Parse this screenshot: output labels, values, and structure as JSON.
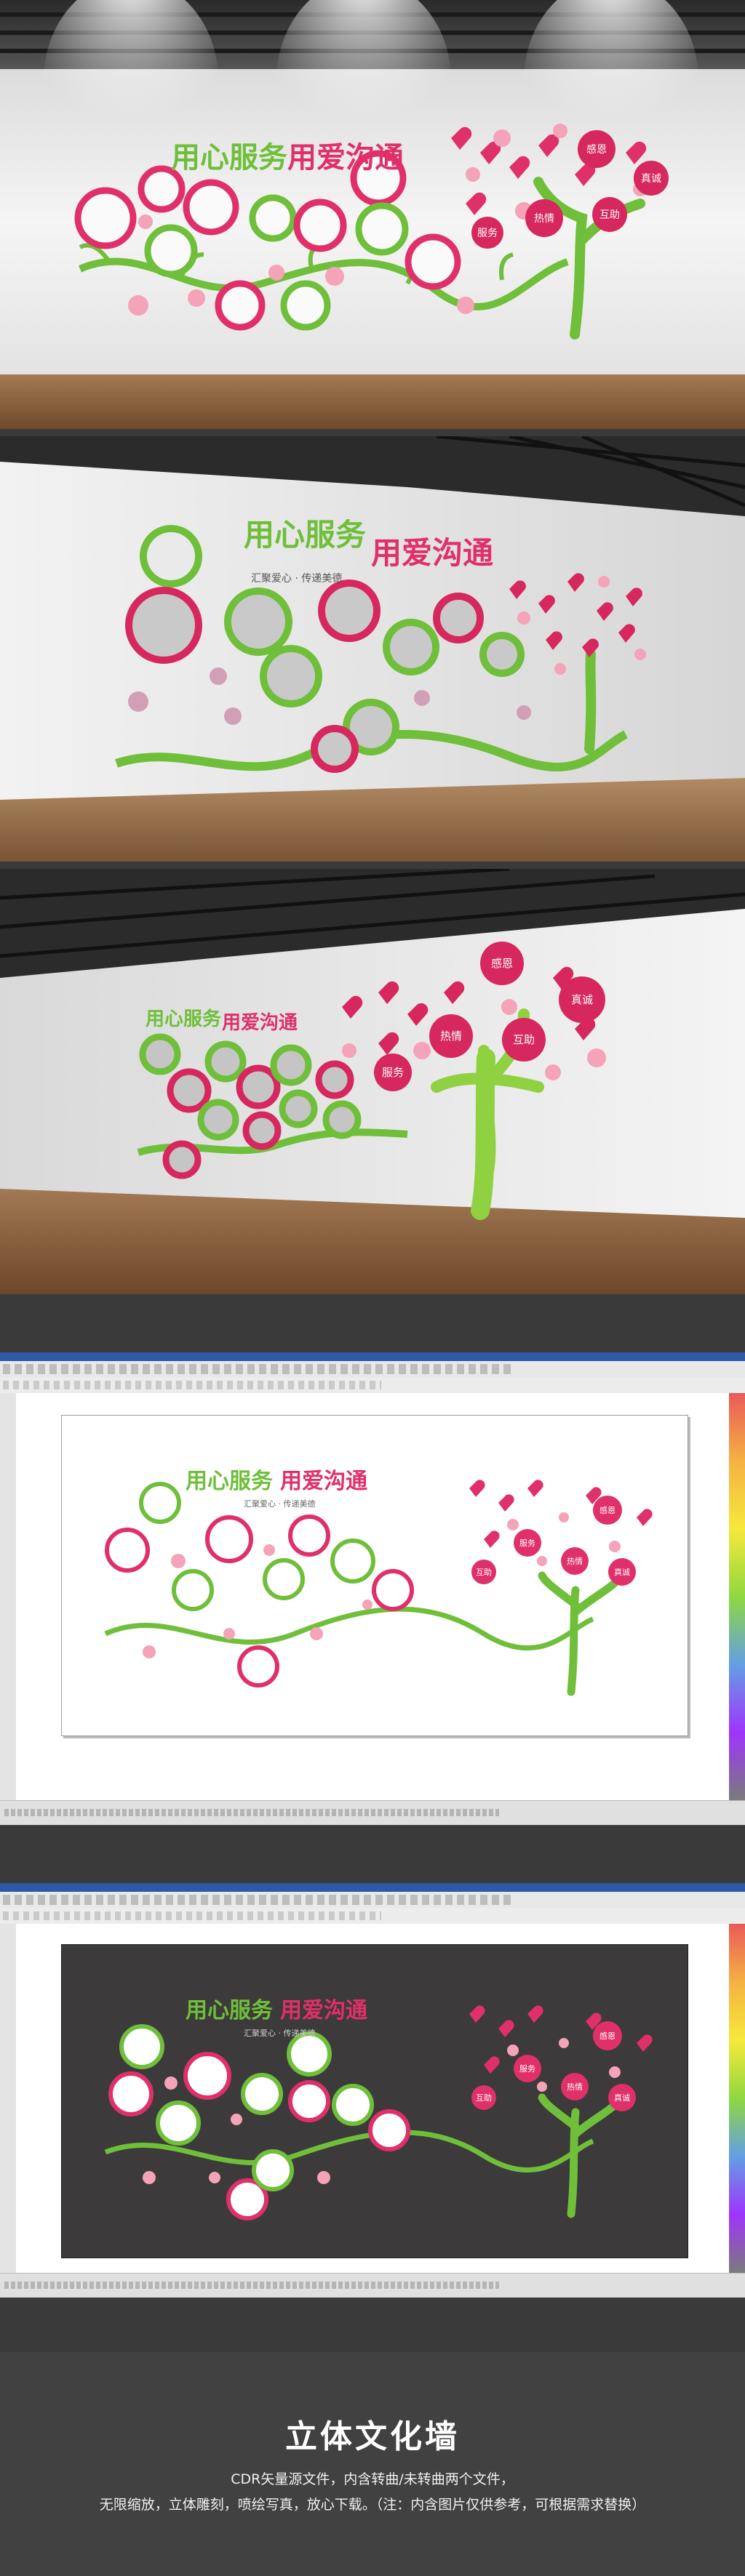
{
  "wall": {
    "slogan_green": "用心服务",
    "slogan_red": "用爱沟通",
    "subtitle": "汇聚爱心 · 传递美德",
    "tree_words": [
      "感恩",
      "热情",
      "真诚",
      "服务",
      "互助"
    ]
  },
  "footer": {
    "title": "立体文化墙",
    "line1": "CDR矢量源文件，内含转曲/未转曲两个文件，",
    "line2": "无限缩放，立体雕刻，喷绘写真，放心下载。（注：内含图片仅供参考，可根据需求替换）"
  },
  "colors": {
    "green": "#6fbf3a",
    "red": "#e0306a",
    "pink": "#f4a3b8",
    "dark_bg": "#3c3a3a"
  }
}
